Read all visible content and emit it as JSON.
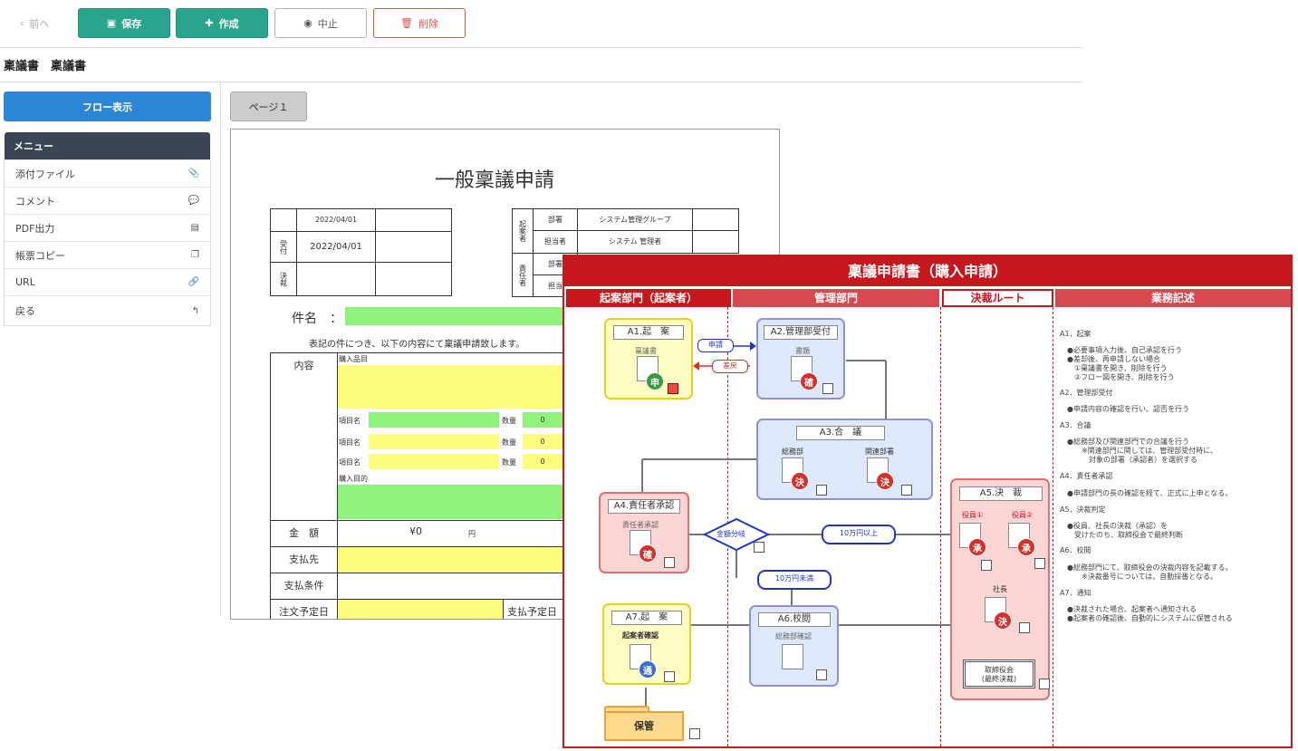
{
  "toolbar": {
    "prev": "前へ",
    "save": "保存",
    "create": "作成",
    "cancel": "中止",
    "delete": "削除"
  },
  "breadcrumb": "稟議書　稟議書",
  "sidebar": {
    "flow_button": "フロー表示",
    "menu_header": "メニュー",
    "items": [
      {
        "label": "添付ファイル",
        "icon": "paperclip-icon"
      },
      {
        "label": "コメント",
        "icon": "comment-icon"
      },
      {
        "label": "PDF出力",
        "icon": "pdf-icon"
      },
      {
        "label": "帳票コピー",
        "icon": "copy-icon"
      },
      {
        "label": "URL",
        "icon": "link-icon"
      },
      {
        "label": "戻る",
        "icon": "back-icon"
      }
    ]
  },
  "page_tab": "ページ１",
  "form": {
    "title": "一般稟議申請",
    "date_top": "2022/04/01",
    "uketsuke": "受付",
    "date_received": "2022/04/01",
    "kessai": "決裁",
    "kianshya": "起案者",
    "busho": "部署",
    "busho_value": "システム管理グループ",
    "tantousha": "担当者",
    "tantousha_value": "システム 管理者",
    "sekininshya": "責任者",
    "busho2": "部署",
    "tantou2": "担当",
    "kenmei": "件名　：",
    "intro": "表記の件につき、以下の内容にて稟議申請致します。",
    "naiyou": "内容",
    "koumoku_title": "購入品目",
    "item_name": "項目名",
    "qty": "数量",
    "qty_values": [
      "0",
      "0",
      "0"
    ],
    "purpose": "購入目的",
    "kingaku": "金　額",
    "amount": "¥0",
    "yen": "円",
    "shiharaisaki": "支払先",
    "shiharai_jouken": "支払条件",
    "chuumon": "注文予定日",
    "shiharai_yotei": "支払予定日"
  },
  "flow": {
    "title": "稟議申請書（購入申請）",
    "col1": "起案部門（起案者）",
    "col2": "管理部門",
    "col3": "決裁ルート",
    "col4": "業務記述",
    "a1": "A1.起　案",
    "a1_doc": "稟議書",
    "a2": "A2.管理部受付",
    "a2_doc": "書類",
    "a3": "A3.合　議",
    "a3_sub1": "総務部",
    "a3_sub2": "関連部署",
    "a4": "A4.責任者承認",
    "a4_doc": "責任者承認",
    "a5": "A5.決　裁",
    "a5_sub1": "役員①",
    "a5_sub2": "役員②",
    "a5_president": "社長",
    "a5_board": "取締役会\n(最終決裁)",
    "a6": "A6.校閲",
    "a6_doc": "総務部確認",
    "a7": "A7.起　案",
    "a7_doc": "起案者確認",
    "hokan": "保管",
    "shinsei": "申請",
    "modoshi": "差戻",
    "kingaku_bunki": "金額分岐",
    "over": "10万円以上",
    "under": "10万円未満",
    "stamp_shin": "申",
    "stamp_kaku": "確",
    "stamp_ketsu": "決",
    "stamp_shou": "承",
    "stamp_tsuu": "通",
    "notes": [
      "A1．起案",
      "　●必要事項入力後、自己承認を行う\n　●差却後、再申請しない場合\n　　①稟議書を開き、削除を行う\n　　②フロー図を開き、削除を行う",
      "A2．管理部受付",
      "　●申請内容の確認を行い、認否を行う",
      "A3．合議",
      "　●総務部及び関連部門での合議を行う\n　　　※関連部門に関しては、管理部受付時に、\n　　　　対象の部署（承認者）を選択する",
      "A4．責任者承認",
      "　●申請部門の長の確認を経て、正式に上申となる。",
      "A5．決裁判定",
      "　●役員、社長の決裁（承認）を\n　　受けたのち、取締役会で最終判断",
      "A6．校閲",
      "　●総務部門にて、取締役会の決裁内容を記載する。\n　　　※決裁番号については、自動採番となる。",
      "A7．通知",
      "　●決裁された場合、起案者へ通知される\n　●起案者の確認後、自動的にシステムに保管される"
    ]
  },
  "colors": {
    "accent_green": "#2aa58d",
    "flow_red": "#c8161d",
    "field_green": "#8ef37a",
    "field_yellow": "#fcfc7d",
    "blue_button": "#2b87d6",
    "menu_dark": "#3a4555"
  }
}
